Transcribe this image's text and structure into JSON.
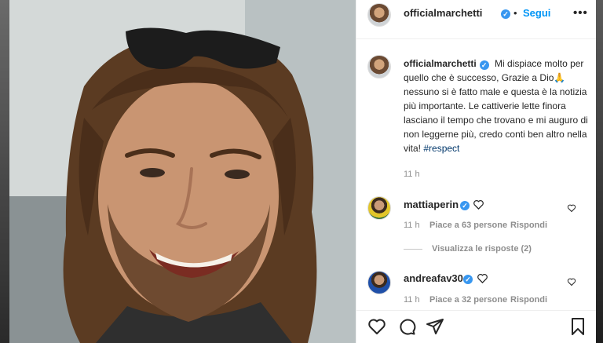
{
  "post": {
    "username": "officialmarchetti",
    "follow_label": "Segui",
    "dot": "•",
    "more_label": "•••"
  },
  "caption": {
    "username": "officialmarchetti",
    "text": "Mi dispiace molto per quello che è successo, Grazie a Dio🙏 nessuno si è fatto male e questa è la notizia più importante. Le cattiverie lette finora lasciano il tempo che trovano e mi auguro di non leggerne più, credo conti ben altro nella vita!",
    "hashtag": "#respect",
    "time": "11 h"
  },
  "comments": [
    {
      "username": "mattiaperin",
      "time": "11 h",
      "likes": "Piace a 63 persone",
      "reply": "Rispondi",
      "view_replies": "Visualizza le risposte (2)"
    },
    {
      "username": "andreafav30",
      "time": "11 h",
      "likes": "Piace a 32 persone",
      "reply": "Rispondi"
    }
  ],
  "icons": {
    "like": "heart-icon",
    "comment": "comment-icon",
    "share": "share-icon",
    "save": "bookmark-icon",
    "verified": "verified-badge-icon",
    "comment_like": "heart-outline-icon"
  },
  "colors": {
    "link_blue": "#0095f6",
    "verified_blue": "#3897f0",
    "hashtag": "#00376b",
    "muted": "#8e8e8e"
  }
}
